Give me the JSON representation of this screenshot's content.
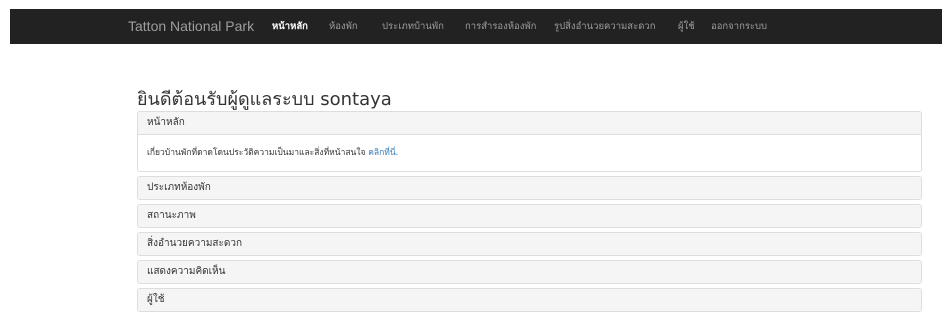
{
  "navbar": {
    "brand": "Tatton National Park",
    "items": [
      {
        "label": "หน้าหลัก",
        "active": true
      },
      {
        "label": "ห้องพัก",
        "active": false
      },
      {
        "label": "ประเภทบ้านพัก",
        "active": false
      },
      {
        "label": "การสำรองห้องพัก",
        "active": false
      },
      {
        "label": "รูปสิ่งอำนวยความสะดวก",
        "active": false
      },
      {
        "label": "ผู้ใช้",
        "active": false
      },
      {
        "label": "ออกจากระบบ",
        "active": false
      }
    ]
  },
  "main": {
    "welcome": "ยินดีต้อนรับผู้ดูแลระบบ sontaya",
    "panels": [
      {
        "title": "หน้าหลัก",
        "body": "เกี่ยวบ้านพักที่ดาดโดนประวัติความเป็นมาและสิ่งที่หน้าสนใจ",
        "link": "คลิกที่นี่."
      },
      {
        "title": "ประเภทห้องพัก"
      },
      {
        "title": "สถานะภาพ"
      },
      {
        "title": "สิ่งอำนวยความสะดวก"
      },
      {
        "title": "แสดงความคิดเห็น"
      },
      {
        "title": "ผู้ใช้"
      }
    ]
  }
}
